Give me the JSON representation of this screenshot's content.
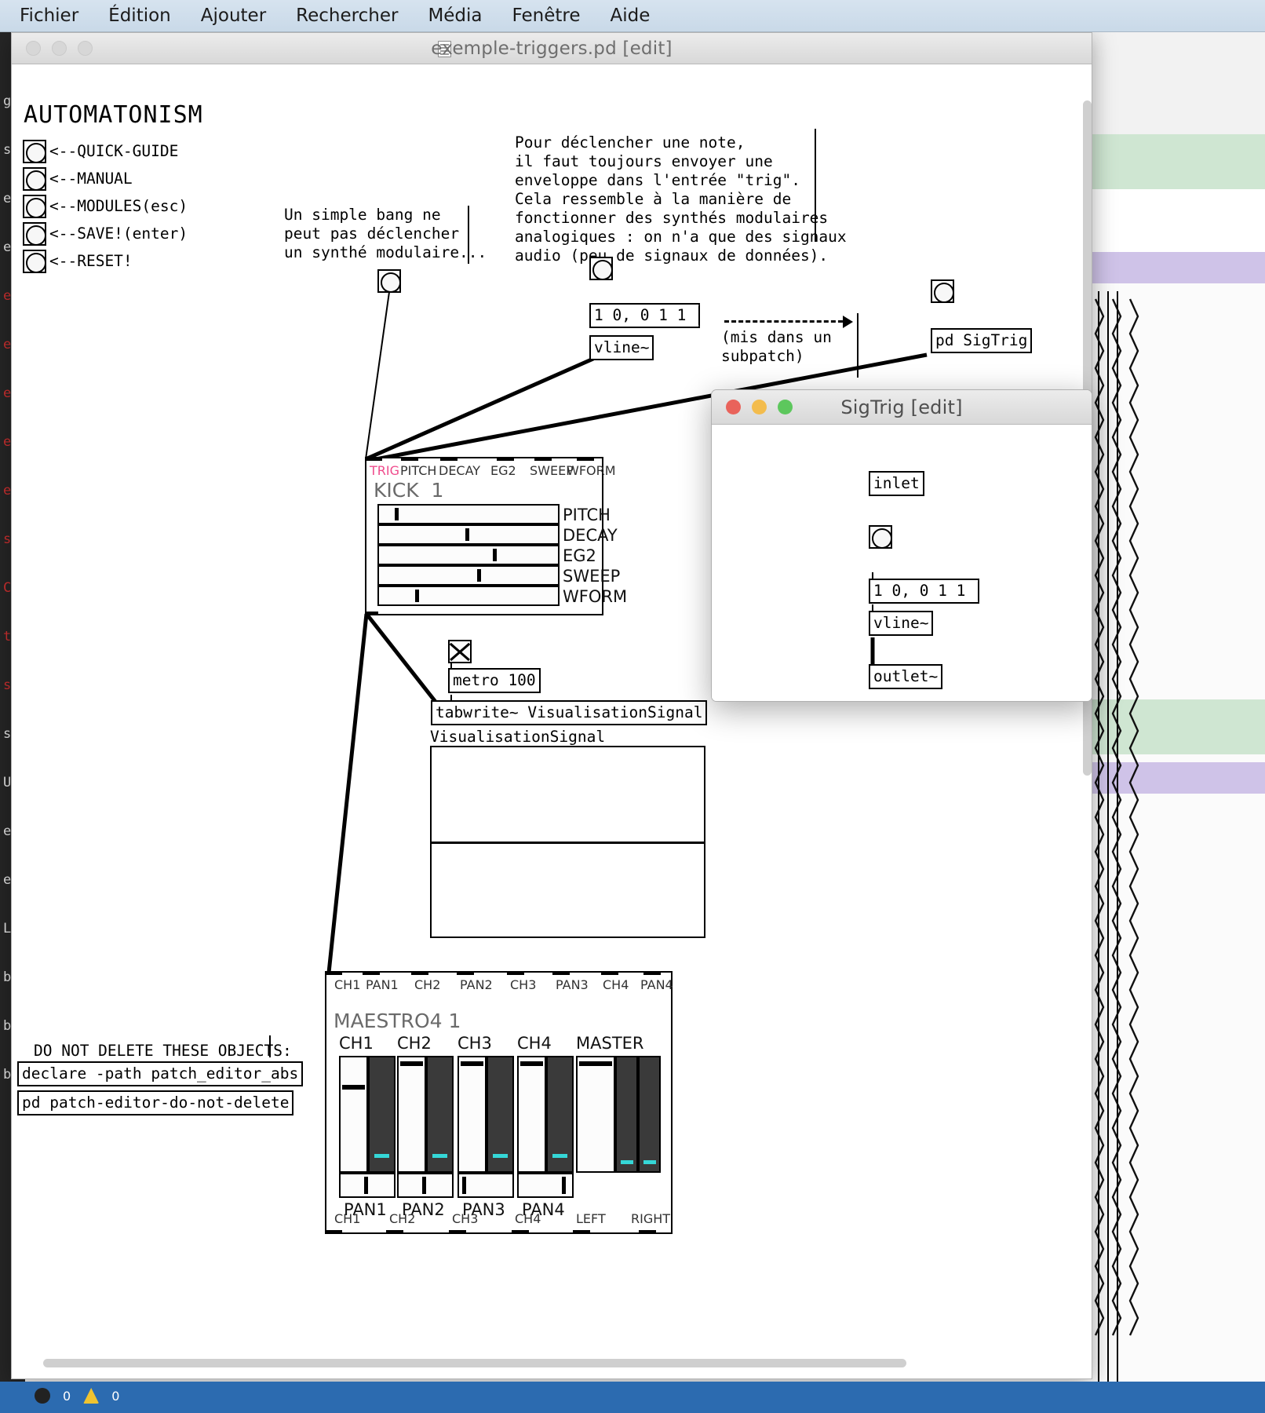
{
  "menubar": {
    "items": [
      "Fichier",
      "Édition",
      "Ajouter",
      "Rechercher",
      "Média",
      "Fenêtre",
      "Aide"
    ]
  },
  "main_window": {
    "title": "exemple-triggers.pd [edit]",
    "doc_icon": "pd-file-icon",
    "traffic": {
      "close": "close-button",
      "minimize": "minimize-button",
      "zoom": "zoom-button"
    }
  },
  "patch": {
    "heading": "AUTOMATONISM",
    "nav": [
      {
        "label": "<--QUICK-GUIDE",
        "bang": "bang-quick-guide"
      },
      {
        "label": "<--MANUAL",
        "bang": "bang-manual"
      },
      {
        "label": "<--MODULES(esc)",
        "bang": "bang-modules"
      },
      {
        "label": "<--SAVE!(enter)",
        "bang": "bang-save"
      },
      {
        "label": "<--RESET!",
        "bang": "bang-reset"
      }
    ],
    "comment_left": "Un simple bang ne\npeut pas déclencher\nun synthé modulaire...",
    "comment_right": "Pour déclencher une note,\nil faut toujours envoyer une\nenveloppe dans l'entrée \"trig\".\nCela ressemble à la manière de\nfonctionner des synthés modulaires\nanalogiques : on n'a que des signaux\naudio (peu de signaux de données).",
    "message_box": "1 0, 0 1 1",
    "vline_object": "vline~",
    "subpatch_note": "(mis dans un\nsubpatch)",
    "pd_sigtrig": "pd SigTrig",
    "metro_toggle": "toggle-metro",
    "metro_object": "metro 100",
    "tabwrite_object": "tabwrite~ VisualisationSignal",
    "array_name": "VisualisationSignal",
    "do_not_delete_comment": "DO NOT DELETE THESE OBJECTS:",
    "declare_object": "declare -path patch_editor_abs",
    "patch_editor_object": "pd patch-editor-do-not-delete"
  },
  "kick_module": {
    "inlets": [
      "TRIG",
      "PITCH",
      "DECAY",
      "EG2",
      "SWEEP",
      "WFORM"
    ],
    "trig_color": "#ef4b8c",
    "title": "KICK  1",
    "params": [
      {
        "label": "PITCH",
        "value": 0.09
      },
      {
        "label": "DECAY",
        "value": 0.5
      },
      {
        "label": "EG2",
        "value": 0.66
      },
      {
        "label": "SWEEP",
        "value": 0.57
      },
      {
        "label": "WFORM",
        "value": 0.21
      }
    ]
  },
  "maestro_module": {
    "inlets": [
      "CH1",
      "PAN1",
      "CH2",
      "PAN2",
      "CH3",
      "PAN3",
      "CH4",
      "PAN4"
    ],
    "title": "MAESTRO4 1",
    "channels": [
      {
        "label": "CH1",
        "fader": 0.26,
        "vu": 0.88,
        "pan_label": "PAN1",
        "pan": 0.5
      },
      {
        "label": "CH2",
        "fader": 0.04,
        "vu": 0.88,
        "pan_label": "PAN2",
        "pan": 0.5
      },
      {
        "label": "CH3",
        "fader": 0.04,
        "vu": 0.88,
        "pan_label": "PAN3",
        "pan": 0.07
      },
      {
        "label": "CH4",
        "fader": 0.04,
        "vu": 0.88,
        "pan_label": "PAN4",
        "pan": 0.92
      }
    ],
    "master": {
      "label": "MASTER",
      "fader": 0.04
    },
    "outlets": [
      "CH1",
      "CH2",
      "CH3",
      "CH4",
      "LEFT",
      "RIGHT"
    ]
  },
  "subwindow": {
    "title": "SigTrig [edit]",
    "inlet": "inlet",
    "bang": "bang-sigtrig",
    "message": "1 0, 0 1 1",
    "vline": "vline~",
    "outlet": "outlet~"
  },
  "left_strip": {
    "lines": [
      "g",
      "s",
      "e",
      "e",
      "e",
      "e",
      "e",
      "e",
      "e",
      "s",
      "C",
      "t",
      "s",
      "s",
      "U",
      "e",
      "e",
      "L",
      "b",
      "b",
      "b"
    ]
  },
  "colors": {
    "accent_pink": "#ef4b8c",
    "vu_cyan": "#35d7d7",
    "taskbar_blue": "#2c6bb0",
    "menubar": "#cddbe8"
  }
}
